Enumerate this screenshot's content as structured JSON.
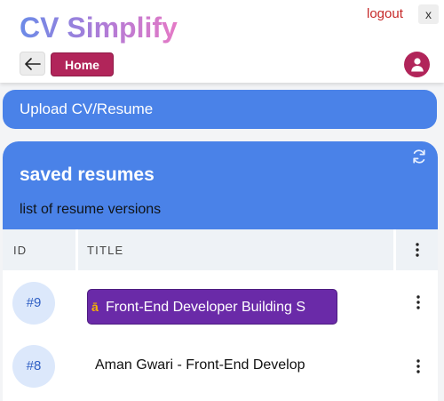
{
  "header": {
    "brand": "CV Simplify",
    "logout_label": "logout",
    "close_label": "x",
    "home_label": "Home"
  },
  "upload": {
    "label": "Upload CV/Resume"
  },
  "saved": {
    "title": "saved resumes",
    "subtitle": "list of resume versions",
    "columns": {
      "id": "ID",
      "title": "TITLE"
    },
    "rows": [
      {
        "id": "#9",
        "title": "Front-End Developer Building S"
      },
      {
        "id": "#8",
        "title": "Aman Gwari - Front-End Develop"
      }
    ]
  },
  "colors": {
    "accent_blue": "#4a82e8",
    "brand_magenta": "#b1255a",
    "highlight_purple": "#6a2aa8"
  },
  "icons": [
    "back-arrow-icon",
    "user-icon",
    "refresh-icon",
    "more-vert-icon",
    "ai-icon"
  ]
}
